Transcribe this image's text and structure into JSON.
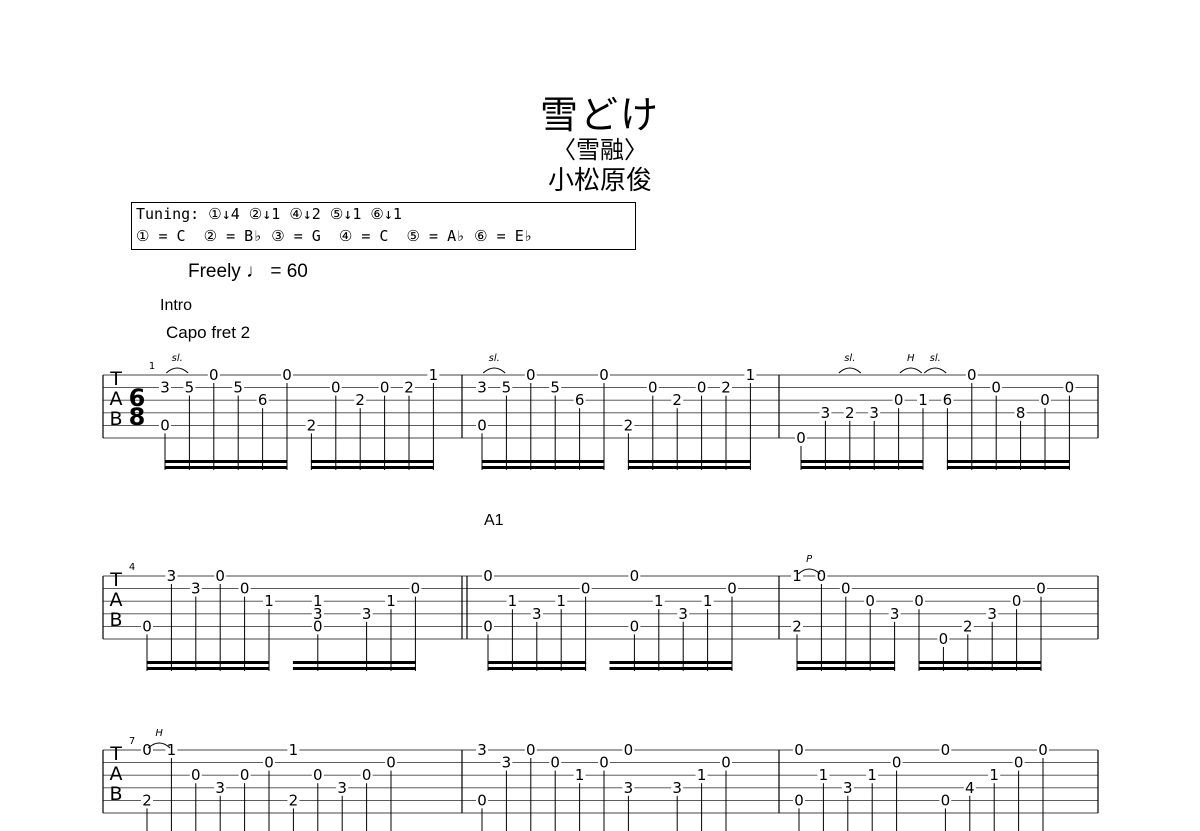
{
  "header": {
    "title": "雪どけ",
    "subtitle": "〈雪融〉",
    "composer": "小松原俊"
  },
  "tuning": {
    "line1": "Tuning: ①↓4 ②↓1 ④↓2 ⑤↓1 ⑥↓1",
    "line2": "① = C  ② = B♭ ③ = G  ④ = C  ⑤ = A♭ ⑥ = E♭"
  },
  "tempo": "Freely ♩ = 60",
  "intro_label": "Intro",
  "capo_label": "Capo fret 2",
  "section_label": "A1",
  "time_signature": {
    "top": "6",
    "bottom": "8"
  },
  "tab_clef": [
    "T",
    "A",
    "B"
  ],
  "systems": [
    {
      "measure_number": "1",
      "measures": [
        {
          "notes": [
            {
              "col": 0,
              "str": 2,
              "t": "3"
            },
            {
              "col": 0,
              "str": 5,
              "t": "0"
            },
            {
              "col": 1,
              "str": 2,
              "t": "5"
            },
            {
              "col": 2,
              "str": 1,
              "t": "0"
            },
            {
              "col": 3,
              "str": 2,
              "t": "5"
            },
            {
              "col": 4,
              "str": 3,
              "t": "6"
            },
            {
              "col": 5,
              "str": 1,
              "t": "0"
            },
            {
              "col": 6,
              "str": 5,
              "t": "2"
            },
            {
              "col": 7,
              "str": 2,
              "t": "0"
            },
            {
              "col": 8,
              "str": 3,
              "t": "2"
            },
            {
              "col": 9,
              "str": 2,
              "t": "0"
            },
            {
              "col": 10,
              "str": 2,
              "t": "2"
            },
            {
              "col": 11,
              "str": 1,
              "t": "1"
            }
          ],
          "marks": [
            {
              "col": 0.5,
              "t": "sl."
            }
          ]
        },
        {
          "notes": [
            {
              "col": 0,
              "str": 2,
              "t": "3"
            },
            {
              "col": 0,
              "str": 5,
              "t": "0"
            },
            {
              "col": 1,
              "str": 2,
              "t": "5"
            },
            {
              "col": 2,
              "str": 1,
              "t": "0"
            },
            {
              "col": 3,
              "str": 2,
              "t": "5"
            },
            {
              "col": 4,
              "str": 3,
              "t": "6"
            },
            {
              "col": 5,
              "str": 1,
              "t": "0"
            },
            {
              "col": 6,
              "str": 5,
              "t": "2"
            },
            {
              "col": 7,
              "str": 2,
              "t": "0"
            },
            {
              "col": 8,
              "str": 3,
              "t": "2"
            },
            {
              "col": 9,
              "str": 2,
              "t": "0"
            },
            {
              "col": 10,
              "str": 2,
              "t": "2"
            },
            {
              "col": 11,
              "str": 1,
              "t": "1"
            }
          ],
          "marks": [
            {
              "col": 0.5,
              "t": "sl."
            }
          ]
        },
        {
          "notes": [
            {
              "col": 0,
              "str": 6,
              "t": "0"
            },
            {
              "col": 1,
              "str": 4,
              "t": "3"
            },
            {
              "col": 2,
              "str": 4,
              "t": "2"
            },
            {
              "col": 3,
              "str": 4,
              "t": "3"
            },
            {
              "col": 4,
              "str": 3,
              "t": "0"
            },
            {
              "col": 5,
              "str": 3,
              "t": "1"
            },
            {
              "col": 6,
              "str": 3,
              "t": "6"
            },
            {
              "col": 7,
              "str": 1,
              "t": "0"
            },
            {
              "col": 8,
              "str": 2,
              "t": "0"
            },
            {
              "col": 9,
              "str": 4,
              "t": "8"
            },
            {
              "col": 10,
              "str": 3,
              "t": "0"
            },
            {
              "col": 11,
              "str": 2,
              "t": "0"
            }
          ],
          "marks": [
            {
              "col": 2,
              "t": "sl."
            },
            {
              "col": 4.5,
              "t": "H"
            },
            {
              "col": 5.5,
              "t": "sl."
            }
          ]
        }
      ]
    },
    {
      "measure_number": "4",
      "measures": [
        {
          "notes": [
            {
              "col": 0,
              "str": 5,
              "t": "0"
            },
            {
              "col": 1,
              "str": 1,
              "t": "3"
            },
            {
              "col": 2,
              "str": 2,
              "t": "3"
            },
            {
              "col": 3,
              "str": 1,
              "t": "0"
            },
            {
              "col": 4,
              "str": 2,
              "t": "0"
            },
            {
              "col": 5,
              "str": 3,
              "t": "1"
            },
            {
              "col": 7,
              "str": 3,
              "t": "1"
            },
            {
              "col": 7,
              "str": 4,
              "t": "3"
            },
            {
              "col": 7,
              "str": 5,
              "t": "0"
            },
            {
              "col": 9,
              "str": 4,
              "t": "3"
            },
            {
              "col": 10,
              "str": 3,
              "t": "1"
            },
            {
              "col": 11,
              "str": 2,
              "t": "0"
            }
          ],
          "marks": []
        },
        {
          "notes": [
            {
              "col": 0,
              "str": 1,
              "t": "0"
            },
            {
              "col": 0,
              "str": 5,
              "t": "0"
            },
            {
              "col": 1,
              "str": 3,
              "t": "1"
            },
            {
              "col": 2,
              "str": 4,
              "t": "3"
            },
            {
              "col": 3,
              "str": 3,
              "t": "1"
            },
            {
              "col": 4,
              "str": 2,
              "t": "0"
            },
            {
              "col": 6,
              "str": 1,
              "t": "0"
            },
            {
              "col": 6,
              "str": 5,
              "t": "0"
            },
            {
              "col": 7,
              "str": 3,
              "t": "1"
            },
            {
              "col": 8,
              "str": 4,
              "t": "3"
            },
            {
              "col": 9,
              "str": 3,
              "t": "1"
            },
            {
              "col": 10,
              "str": 2,
              "t": "0"
            }
          ],
          "marks": []
        },
        {
          "notes": [
            {
              "col": 0,
              "str": 1,
              "t": "1"
            },
            {
              "col": 0,
              "str": 5,
              "t": "2"
            },
            {
              "col": 1,
              "str": 1,
              "t": "0"
            },
            {
              "col": 2,
              "str": 2,
              "t": "0"
            },
            {
              "col": 3,
              "str": 3,
              "t": "0"
            },
            {
              "col": 4,
              "str": 4,
              "t": "3"
            },
            {
              "col": 5,
              "str": 3,
              "t": "0"
            },
            {
              "col": 6,
              "str": 6,
              "t": "0"
            },
            {
              "col": 7,
              "str": 5,
              "t": "2"
            },
            {
              "col": 8,
              "str": 4,
              "t": "3"
            },
            {
              "col": 9,
              "str": 3,
              "t": "0"
            },
            {
              "col": 10,
              "str": 2,
              "t": "0"
            }
          ],
          "marks": [
            {
              "col": 0.5,
              "t": "P"
            }
          ]
        }
      ]
    },
    {
      "measure_number": "7",
      "measures": [
        {
          "notes": [
            {
              "col": 0,
              "str": 1,
              "t": "0"
            },
            {
              "col": 0,
              "str": 5,
              "t": "2"
            },
            {
              "col": 1,
              "str": 1,
              "t": "1"
            },
            {
              "col": 2,
              "str": 3,
              "t": "0"
            },
            {
              "col": 3,
              "str": 4,
              "t": "3"
            },
            {
              "col": 4,
              "str": 3,
              "t": "0"
            },
            {
              "col": 5,
              "str": 2,
              "t": "0"
            },
            {
              "col": 6,
              "str": 1,
              "t": "1"
            },
            {
              "col": 6,
              "str": 5,
              "t": "2"
            },
            {
              "col": 7,
              "str": 3,
              "t": "0"
            },
            {
              "col": 8,
              "str": 4,
              "t": "3"
            },
            {
              "col": 9,
              "str": 3,
              "t": "0"
            },
            {
              "col": 10,
              "str": 2,
              "t": "0"
            }
          ],
          "marks": [
            {
              "col": 0.5,
              "t": "H"
            }
          ]
        },
        {
          "notes": [
            {
              "col": 0,
              "str": 1,
              "t": "3"
            },
            {
              "col": 0,
              "str": 5,
              "t": "0"
            },
            {
              "col": 1,
              "str": 2,
              "t": "3"
            },
            {
              "col": 2,
              "str": 1,
              "t": "0"
            },
            {
              "col": 3,
              "str": 2,
              "t": "0"
            },
            {
              "col": 4,
              "str": 3,
              "t": "1"
            },
            {
              "col": 5,
              "str": 2,
              "t": "0"
            },
            {
              "col": 6,
              "str": 1,
              "t": "0"
            },
            {
              "col": 6,
              "str": 4,
              "t": "3"
            },
            {
              "col": 8,
              "str": 4,
              "t": "3"
            },
            {
              "col": 9,
              "str": 3,
              "t": "1"
            },
            {
              "col": 10,
              "str": 2,
              "t": "0"
            }
          ],
          "marks": []
        },
        {
          "notes": [
            {
              "col": 0,
              "str": 1,
              "t": "0"
            },
            {
              "col": 0,
              "str": 5,
              "t": "0"
            },
            {
              "col": 1,
              "str": 3,
              "t": "1"
            },
            {
              "col": 2,
              "str": 4,
              "t": "3"
            },
            {
              "col": 3,
              "str": 3,
              "t": "1"
            },
            {
              "col": 4,
              "str": 2,
              "t": "0"
            },
            {
              "col": 6,
              "str": 1,
              "t": "0"
            },
            {
              "col": 6,
              "str": 5,
              "t": "0"
            },
            {
              "col": 7,
              "str": 4,
              "t": "4"
            },
            {
              "col": 8,
              "str": 3,
              "t": "1"
            },
            {
              "col": 9,
              "str": 2,
              "t": "0"
            },
            {
              "col": 10,
              "str": 1,
              "t": "0"
            }
          ],
          "marks": []
        }
      ]
    }
  ]
}
